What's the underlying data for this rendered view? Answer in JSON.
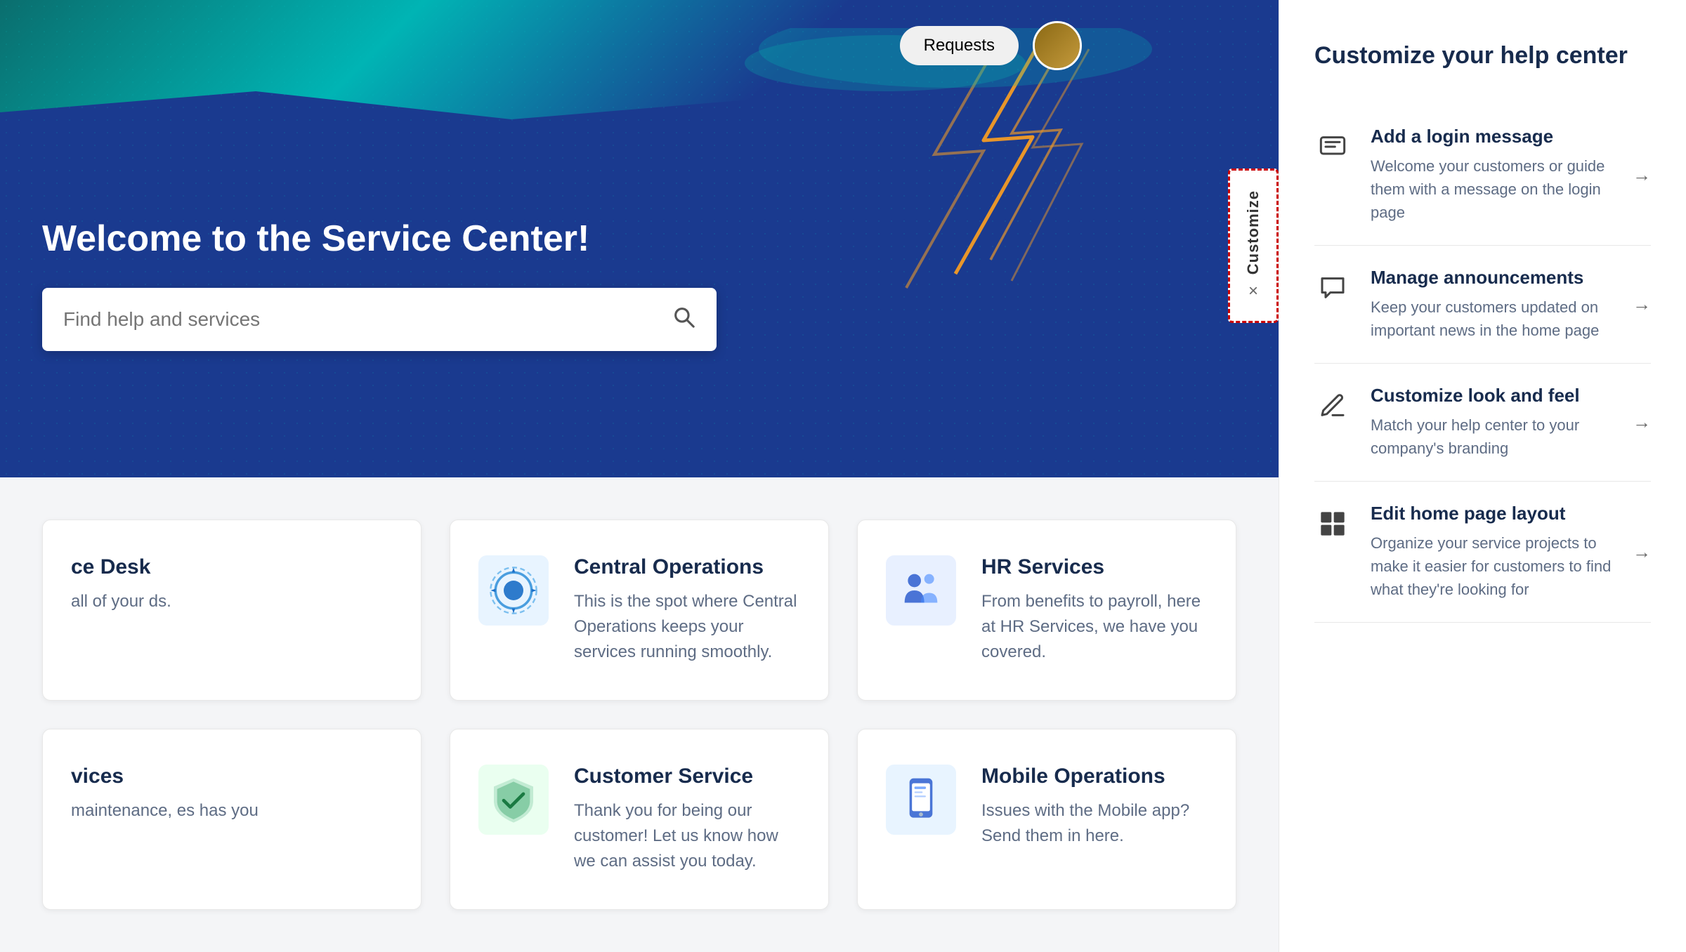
{
  "hero": {
    "title": "Welcome to the Service Center!",
    "search_placeholder": "Find help and services",
    "requests_label": "Requests"
  },
  "customize_tab": {
    "label": "Customize",
    "close_label": "×"
  },
  "sidebar": {
    "title": "Customize your help center",
    "items": [
      {
        "id": "login-message",
        "title": "Add a login message",
        "desc": "Welcome your customers or guide them with a message on the login page",
        "icon": "💬"
      },
      {
        "id": "announcements",
        "title": "Manage announcements",
        "desc": "Keep your customers updated on important news in the home page",
        "icon": "📌"
      },
      {
        "id": "look-feel",
        "title": "Customize look and feel",
        "desc": "Match your help center to your company's branding",
        "icon": "✏️"
      },
      {
        "id": "home-layout",
        "title": "Edit home page layout",
        "desc": "Organize your service projects to make it easier for customers to find what they're looking for",
        "icon": "▦"
      }
    ]
  },
  "service_cards": {
    "partial_left_1": {
      "title": "ce Desk",
      "desc": "all of your ds."
    },
    "partial_left_2": {
      "title": "vices",
      "desc": "maintenance, es has you"
    },
    "cards": [
      {
        "title": "Central Operations",
        "desc": "This is the spot where Central Operations keeps your services running smoothly.",
        "icon": "⚙️",
        "icon_bg": "#e8f4ff"
      },
      {
        "title": "HR Services",
        "desc": "From benefits to payroll, here at HR Services, we have you covered.",
        "icon": "🎯",
        "icon_bg": "#e8f0ff"
      },
      {
        "title": "Customer Service",
        "desc": "Thank you for being our customer! Let us know how we can assist you today.",
        "icon": "🛡️",
        "icon_bg": "#eafff0"
      },
      {
        "title": "Mobile Operations",
        "desc": "Issues with the Mobile app? Send them in here.",
        "icon": "📱",
        "icon_bg": "#e8f4ff"
      }
    ]
  }
}
